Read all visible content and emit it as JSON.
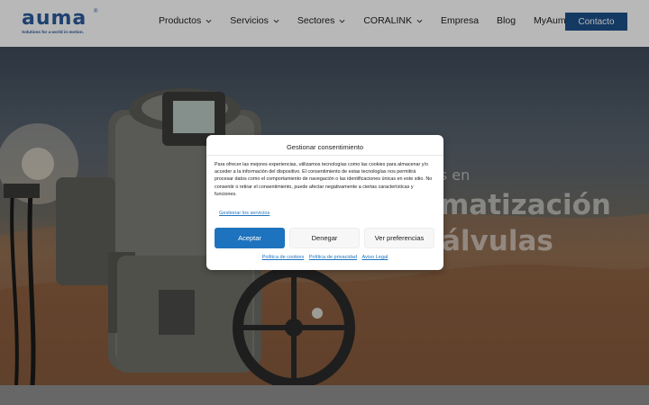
{
  "header": {
    "logo_text": "auma",
    "logo_registered": "®",
    "logo_tagline": "Solutions for a world in motion.",
    "nav": [
      {
        "label": "Productos",
        "has_dropdown": true
      },
      {
        "label": "Servicios",
        "has_dropdown": true
      },
      {
        "label": "Sectores",
        "has_dropdown": true
      },
      {
        "label": "CORALINK",
        "has_dropdown": true
      },
      {
        "label": "Empresa",
        "has_dropdown": false
      },
      {
        "label": "Blog",
        "has_dropdown": false
      },
      {
        "label": "MyAuma",
        "has_dropdown": false
      }
    ],
    "contact_label": "Contacto",
    "brand_color": "#2b5a9b",
    "contact_color": "#1d4f8a"
  },
  "hero": {
    "line1": "as en",
    "line2": "matización",
    "line3": "álvulas"
  },
  "consent": {
    "title": "Gestionar consentimiento",
    "body": "Para ofrecer las mejores experiencias, utilizamos tecnologías como las cookies para almacenar y/o acceder a la información del dispositivo. El consentimiento de estas tecnologías nos permitirá procesar datos como el comportamiento de navegación o las identificaciones únicas en este sitio. No consentir o retirar el consentimiento, puede afectar negativamente a ciertas características y funciones.",
    "manage_link": "Gestionar los servicios",
    "accept_label": "Aceptar",
    "deny_label": "Denegar",
    "prefs_label": "Ver preferencias",
    "links": [
      "Política de cookies",
      "Política de privacidad",
      "Aviso Legal"
    ],
    "accent_color": "#1e73be"
  }
}
